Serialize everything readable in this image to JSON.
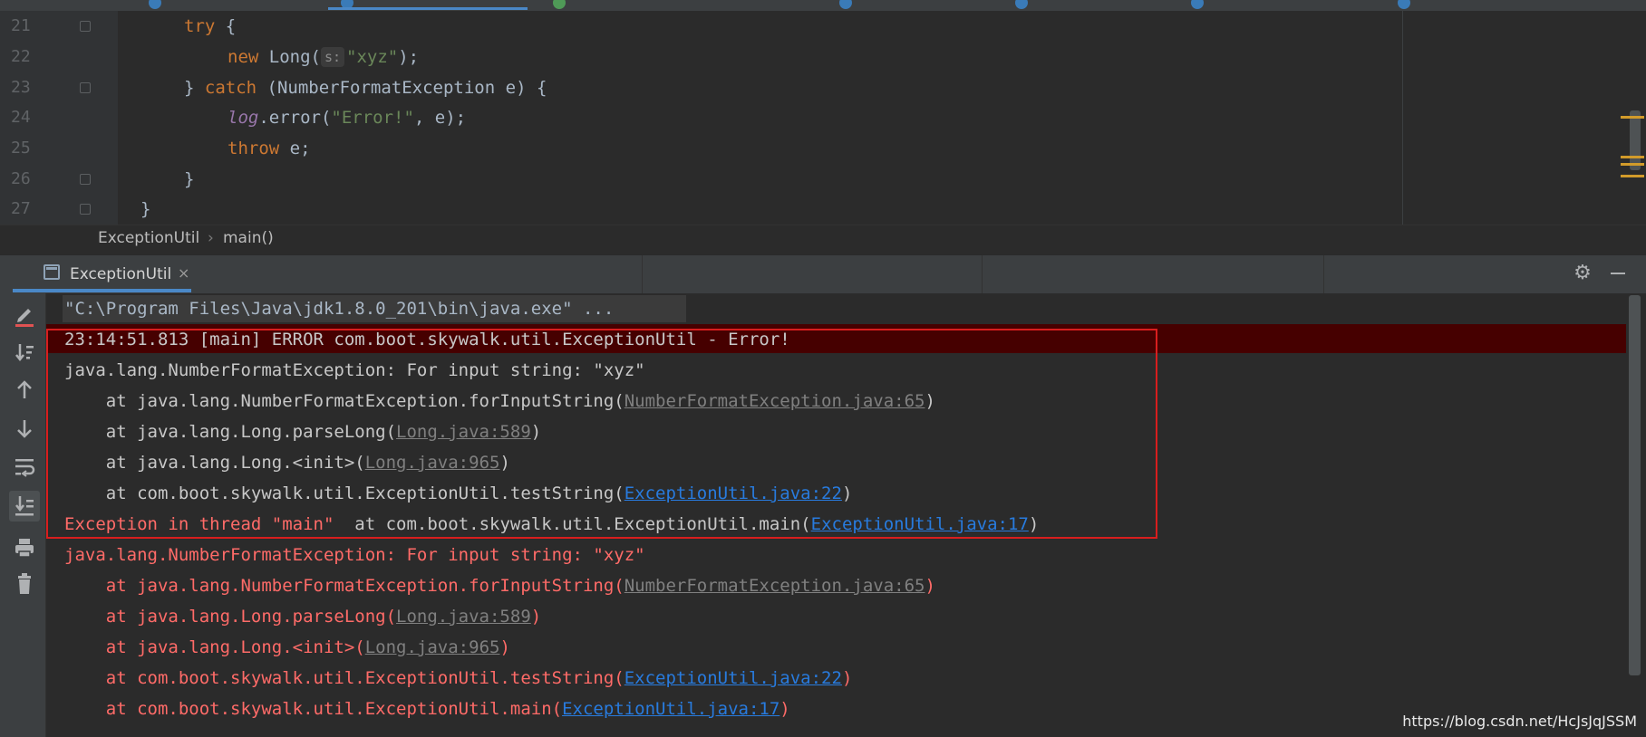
{
  "editor": {
    "line_numbers": [
      "21",
      "22",
      "23",
      "24",
      "25",
      "26",
      "27"
    ],
    "code": {
      "l21_kw": "try",
      "l21_rest": " {",
      "l22_kw": "new",
      "l22_mid": " Long(",
      "l22_hint": "s:",
      "l22_str": "\"xyz\"",
      "l22_end": ");",
      "l23_a": "} ",
      "l23_kw": "catch",
      "l23_b": " (NumberFormatException e) {",
      "l24_log": "log",
      "l24_mid": ".error(",
      "l24_str": "\"Error!\"",
      "l24_end": ", e);",
      "l25_kw": "throw",
      "l25_rest": " e;",
      "l26": "}",
      "l27": "}"
    }
  },
  "breadcrumb": {
    "class": "ExceptionUtil",
    "separator": "›",
    "method": "main()"
  },
  "run_panel": {
    "tab_label": "ExceptionUtil",
    "tab_close": "×",
    "settings_icon": "gear-icon",
    "minimize_icon": "minus-icon"
  },
  "console": {
    "command": "\"C:\\Program Files\\Java\\jdk1.8.0_201\\bin\\java.exe\" ...",
    "log_line": "23:14:51.813 [main] ERROR com.boot.skywalk.util.ExceptionUtil - Error!",
    "out_exception": "java.lang.NumberFormatException: For input string: \"xyz\"",
    "out_st1_pre": "    at java.lang.NumberFormatException.forInputString(",
    "out_st1_link": "NumberFormatException.java:65",
    "out_st2_pre": "    at java.lang.Long.parseLong(",
    "out_st2_link": "Long.java:589",
    "out_st3_pre": "    at java.lang.Long.<init>(",
    "out_st3_link": "Long.java:965",
    "out_st4_pre": "    at com.boot.skywalk.util.ExceptionUtil.testString(",
    "out_st4_link": "ExceptionUtil.java:22",
    "err_thread": "Exception in thread \"main\" ",
    "out_st5_pre": " at com.boot.skywalk.util.ExceptionUtil.main(",
    "out_st5_link": "ExceptionUtil.java:17",
    "close_paren": ")",
    "err_exception": "java.lang.NumberFormatException: For input string: \"xyz\"",
    "err_st1_pre": "    at java.lang.NumberFormatException.forInputString(",
    "err_st1_link": "NumberFormatException.java:65",
    "err_st2_pre": "    at java.lang.Long.parseLong(",
    "err_st2_link": "Long.java:589",
    "err_st3_pre": "    at java.lang.Long.<init>(",
    "err_st3_link": "Long.java:965",
    "err_st4_pre": "    at com.boot.skywalk.util.ExceptionUtil.testString(",
    "err_st4_link": "ExceptionUtil.java:22",
    "err_st5_pre": "    at com.boot.skywalk.util.ExceptionUtil.main(",
    "err_st5_link": "ExceptionUtil.java:17"
  },
  "toolbar_icons": [
    "edit-icon",
    "sort-down-icon",
    "arrow-up-icon",
    "arrow-down-icon",
    "soft-wrap-icon",
    "scroll-to-end-icon",
    "print-icon",
    "trash-icon"
  ],
  "watermark": "https://blog.csdn.net/HcJsJqJSSM",
  "colors": {
    "keyword": "#cc7832",
    "string": "#6a8759",
    "error_text": "#ff6b68",
    "link": "#287bde",
    "highlight_box": "#d81e1e"
  }
}
